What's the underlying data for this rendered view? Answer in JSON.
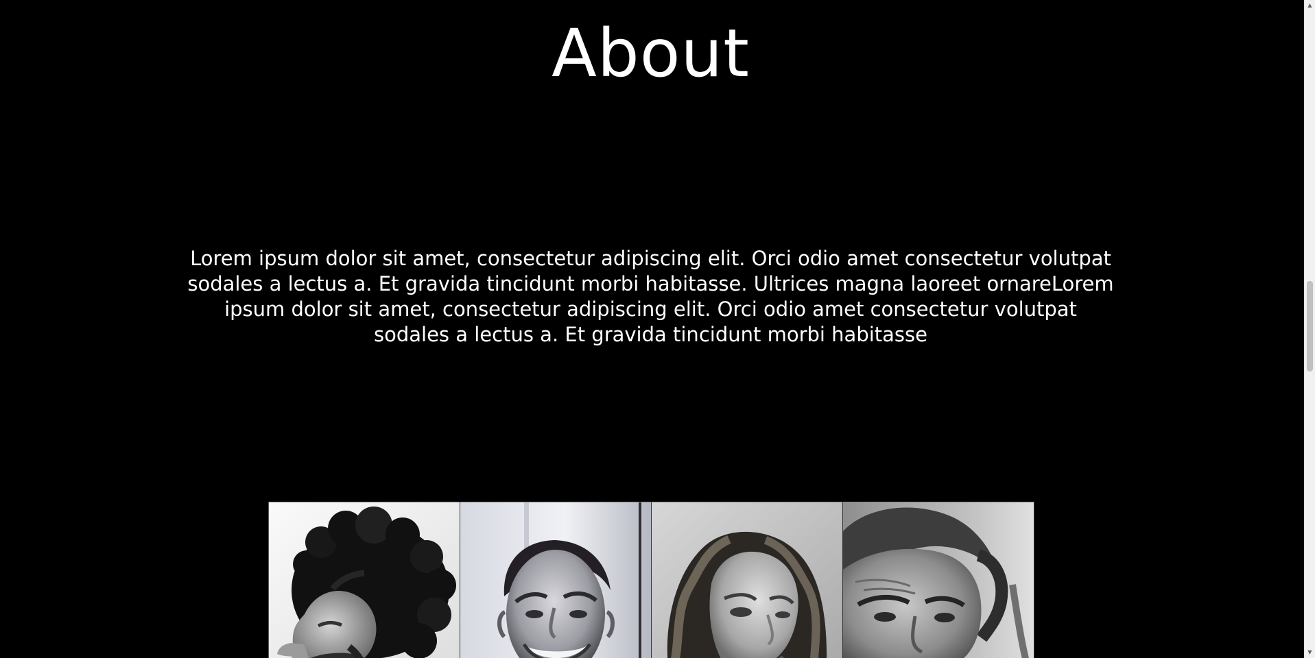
{
  "about": {
    "title": "About",
    "text": "Lorem ipsum dolor sit amet, consectetur adipiscing elit. Orci odio amet consectetur volutpat sodales a lectus a. Et gravida tincidunt morbi habitasse. Ultrices magna laoreet ornareLorem ipsum dolor sit amet, consectetur adipiscing elit. Orci odio amet consectetur volutpat sodales a lectus a. Et gravida tincidunt morbi habitasse"
  },
  "team_photos": {
    "count": 4,
    "style": "black-and-white portraits"
  },
  "scrollbar": {
    "up_icon": "up-arrow-icon",
    "down_icon": "down-arrow-icon"
  },
  "colors": {
    "background": "#000000",
    "text": "#ffffff",
    "scrollbar_track": "#f1f1f1",
    "scrollbar_thumb": "#c1c1c1"
  }
}
